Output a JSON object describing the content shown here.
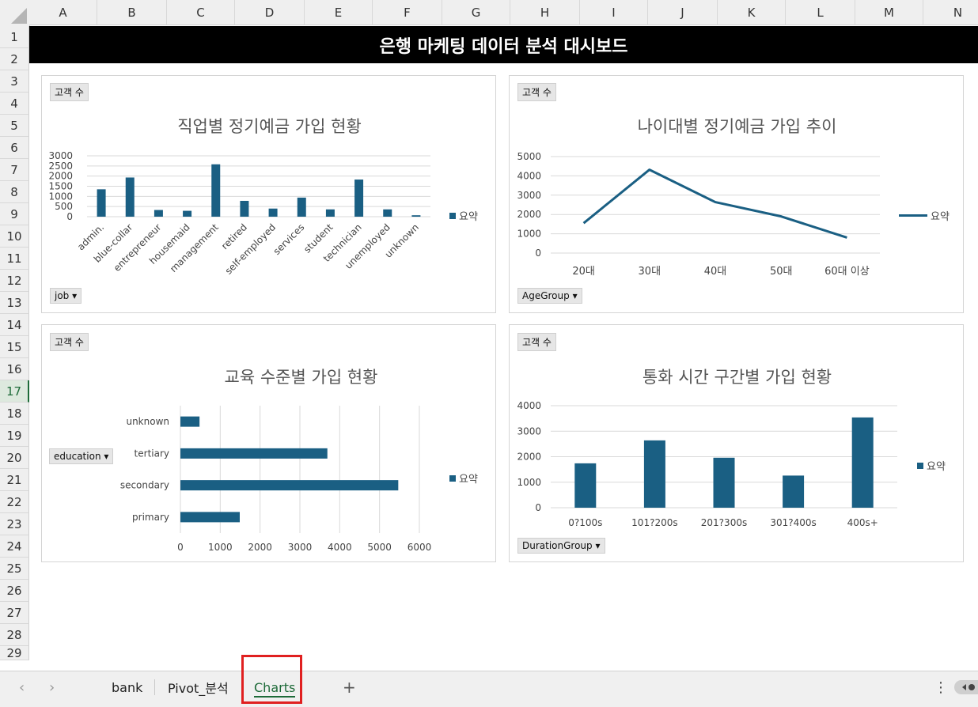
{
  "columns": [
    "A",
    "B",
    "C",
    "D",
    "E",
    "F",
    "G",
    "H",
    "I",
    "J",
    "K",
    "L",
    "M",
    "N"
  ],
  "rows": [
    "1",
    "2",
    "3",
    "4",
    "5",
    "6",
    "7",
    "8",
    "9",
    "10",
    "11",
    "12",
    "13",
    "14",
    "15",
    "16",
    "17",
    "18",
    "19",
    "20",
    "21",
    "22",
    "23",
    "24",
    "25",
    "26",
    "27",
    "28",
    "29"
  ],
  "active_row": "17",
  "dashboard_title": "은행 마케팅 데이터 분석 대시보드",
  "legend_label": "요약",
  "value_field": "고객 수",
  "accent_color": "#1a5f83",
  "charts": {
    "job": {
      "title": "직업별 정기예금 가입 현황",
      "filter_label": "job"
    },
    "age": {
      "title": "나이대별 정기예금 가입 추이",
      "filter_label": "AgeGroup"
    },
    "education": {
      "title": "교육 수준별 가입 현황",
      "filter_label": "education"
    },
    "duration": {
      "title": "통화 시간 구간별 가입 현황",
      "filter_label": "DurationGroup"
    }
  },
  "chart_data": [
    {
      "type": "bar",
      "title": "직업별 정기예금 가입 현황",
      "categories": [
        "admin.",
        "blue-collar",
        "entrepreneur",
        "housemaid",
        "management",
        "retired",
        "self-employed",
        "services",
        "student",
        "technician",
        "unemployed",
        "unknown"
      ],
      "series": [
        {
          "name": "요약",
          "values": [
            1350,
            1930,
            330,
            290,
            2580,
            780,
            400,
            940,
            360,
            1830,
            360,
            70
          ]
        }
      ],
      "yticks": [
        "0",
        "500",
        "1000",
        "1500",
        "2000",
        "2500",
        "3000"
      ],
      "ylim": [
        0,
        3000
      ]
    },
    {
      "type": "line",
      "title": "나이대별 정기예금 가입 추이",
      "categories": [
        "20대",
        "30대",
        "40대",
        "50대",
        "60대 이상"
      ],
      "series": [
        {
          "name": "요약",
          "values": [
            1550,
            4320,
            2640,
            1900,
            800
          ]
        }
      ],
      "yticks": [
        "0",
        "1000",
        "2000",
        "3000",
        "4000",
        "5000"
      ],
      "ylim": [
        0,
        5000
      ]
    },
    {
      "type": "bar",
      "orientation": "horizontal",
      "title": "교육 수준별 가입 현황",
      "categories": [
        "unknown",
        "tertiary",
        "secondary",
        "primary"
      ],
      "series": [
        {
          "name": "요약",
          "values": [
            480,
            3690,
            5470,
            1490
          ]
        }
      ],
      "xticks": [
        "0",
        "1000",
        "2000",
        "3000",
        "4000",
        "5000",
        "6000"
      ],
      "xlim": [
        0,
        6000
      ]
    },
    {
      "type": "bar",
      "title": "통화 시간 구간별 가입 현황",
      "categories": [
        "0?100s",
        "101?200s",
        "201?300s",
        "301?400s",
        "400s+"
      ],
      "series": [
        {
          "name": "요약",
          "values": [
            1740,
            2640,
            1960,
            1260,
            3540
          ]
        }
      ],
      "yticks": [
        "0",
        "1000",
        "2000",
        "3000",
        "4000"
      ],
      "ylim": [
        0,
        4000
      ]
    }
  ],
  "sheet_tabs": [
    {
      "label": "bank",
      "active": false
    },
    {
      "label": "Pivot_분석",
      "active": false
    },
    {
      "label": "Charts",
      "active": true
    }
  ],
  "add_sheet_label": "+",
  "more_label": "⋮"
}
